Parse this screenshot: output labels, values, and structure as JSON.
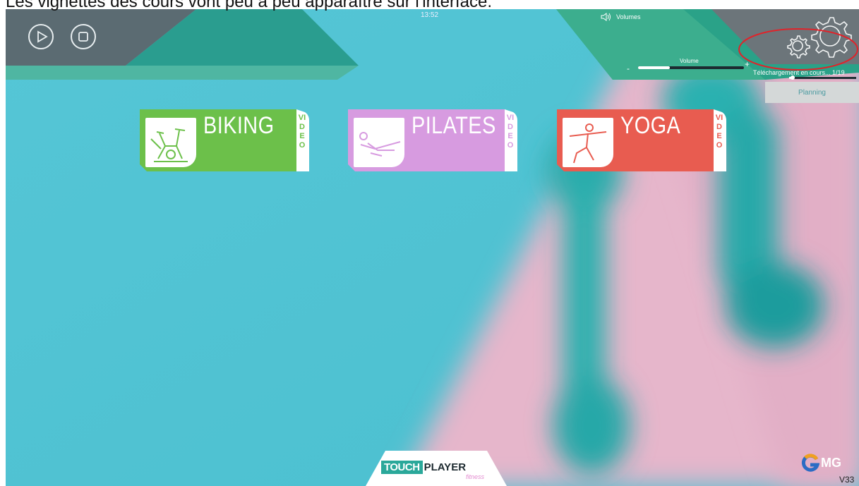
{
  "caption": "Les vignettes des cours vont peu à peu apparaître sur l'interface.",
  "status": {
    "clock": "13:52"
  },
  "player_controls": {
    "play_icon": "play-icon",
    "stop_icon": "stop-icon"
  },
  "volume": {
    "title": "Volumes",
    "label": "Volume",
    "minus": "-",
    "plus": "+",
    "level": 0.3
  },
  "download": {
    "text": "Téléchargement en cours... 1/19",
    "progress": 0.05
  },
  "planning_button": "Planning",
  "settings_icon": "gear-icon",
  "tiles": [
    {
      "title": "BIKING",
      "side": "VIDEO",
      "color": "#6cc04a",
      "icon": "bike-icon"
    },
    {
      "title": "PILATES",
      "side": "VIDEO",
      "color": "#d79be0",
      "icon": "pilates-icon"
    },
    {
      "title": "YOGA",
      "side": "VIDEO",
      "color": "#e85c50",
      "icon": "yoga-icon"
    }
  ],
  "logo": {
    "touch": "TOUCH",
    "player": "PLAYER",
    "fitness": "fitness"
  },
  "brand": {
    "text": "MG"
  },
  "version": "V33",
  "colors": {
    "teal_bar": "#2a9d8f",
    "accent_green": "#3cae8e",
    "highlight_red": "#e0232a"
  }
}
